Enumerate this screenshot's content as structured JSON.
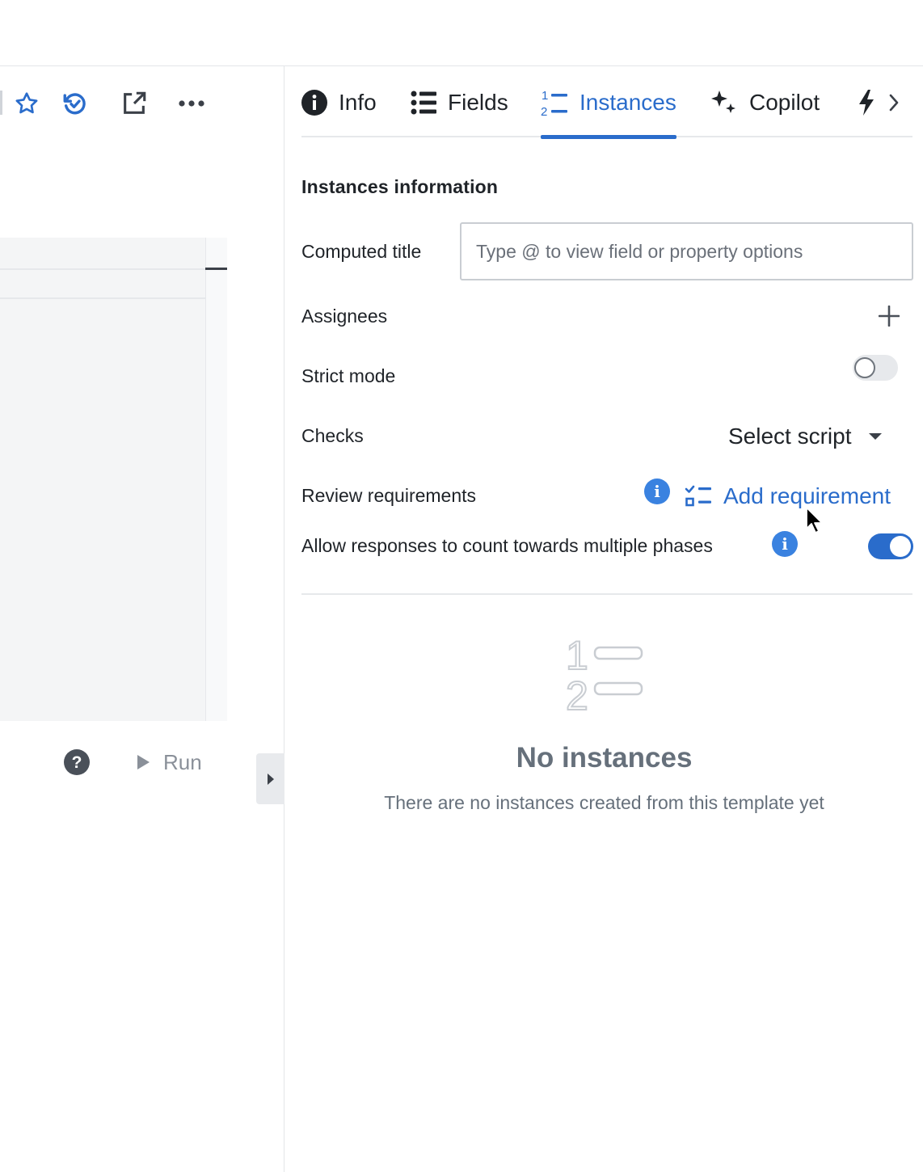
{
  "toolbar": {
    "icons": [
      "star-icon",
      "history-icon",
      "open-external-icon",
      "more-icon"
    ]
  },
  "left_footer": {
    "run_label": "Run"
  },
  "tabs": [
    {
      "label": "Info",
      "icon": "info-icon",
      "active": false
    },
    {
      "label": "Fields",
      "icon": "list-icon",
      "active": false
    },
    {
      "label": "Instances",
      "icon": "numbered-list-icon",
      "active": true
    },
    {
      "label": "Copilot",
      "icon": "sparkle-icon",
      "active": false
    },
    {
      "label": "",
      "icon": "bolt-icon",
      "active": false
    }
  ],
  "panel": {
    "section_title": "Instances information",
    "computed_title": {
      "label": "Computed title",
      "placeholder": "Type @ to view field or property options",
      "value": ""
    },
    "assignees_label": "Assignees",
    "strict_mode": {
      "label": "Strict mode",
      "on": false
    },
    "checks": {
      "label": "Checks",
      "select_label": "Select script"
    },
    "review_requirements": {
      "label": "Review requirements",
      "add_label": "Add requirement"
    },
    "multiple_phases": {
      "label": "Allow responses to count towards multiple phases",
      "on": true
    }
  },
  "empty_state": {
    "title": "No instances",
    "subtitle": "There are no instances created from this template yet"
  },
  "colors": {
    "accent": "#2a6ccb",
    "info_badge": "#3a82e0",
    "muted_text": "#66707b"
  }
}
